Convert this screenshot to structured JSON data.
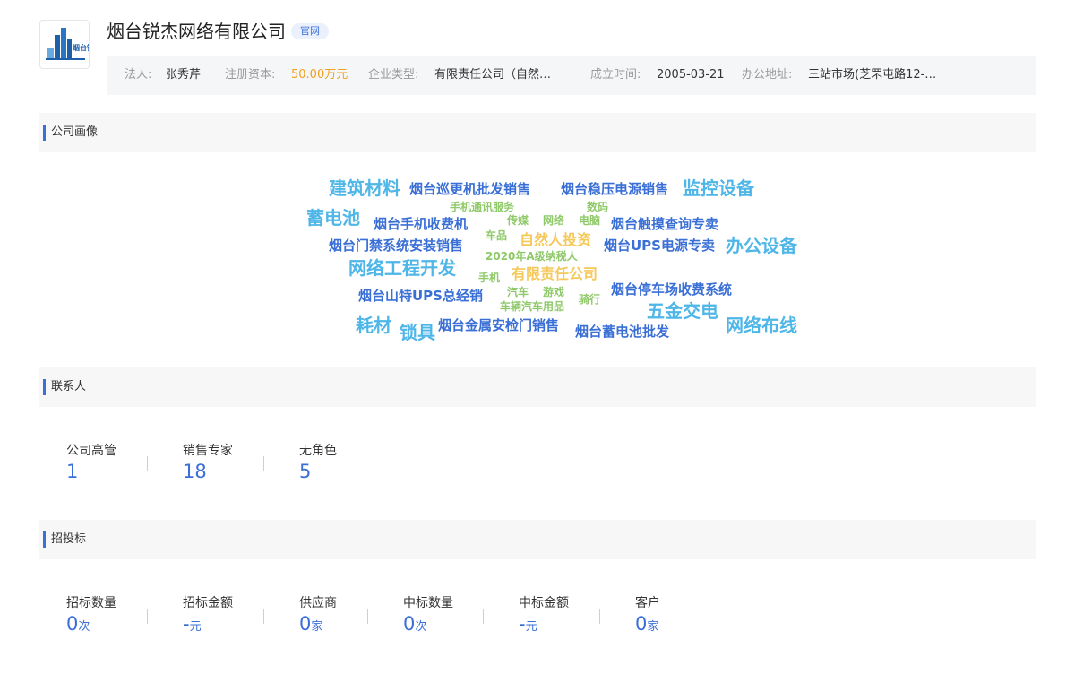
{
  "company": {
    "name": "烟台锐杰网络有限公司",
    "badge": "官网",
    "logo_text": "烟台锐杰"
  },
  "info": {
    "legal_rep_label": "法人:",
    "legal_rep": "张秀芹",
    "capital_label": "注册资本:",
    "capital": "50.00万元",
    "type_label": "企业类型:",
    "type": "有限责任公司（自然…",
    "founded_label": "成立时间:",
    "founded": "2005-03-21",
    "address_label": "办公地址:",
    "address": "三站市场(芝罘屯路12-…"
  },
  "sections": {
    "portrait": "公司画像",
    "contacts": "联系人",
    "bidding": "招投标"
  },
  "word_cloud": [
    {
      "text": "建筑材料",
      "color": "#4fb6e8"
    },
    {
      "text": "烟台巡更机批发销售",
      "color": "#3a6fd6"
    },
    {
      "text": "烟台稳压电源销售",
      "color": "#3a6fd6"
    },
    {
      "text": "监控设备",
      "color": "#4fb6e8"
    },
    {
      "text": "手机通讯服务",
      "color": "#8fc96a"
    },
    {
      "text": "数码",
      "color": "#8fc96a"
    },
    {
      "text": "蓄电池",
      "color": "#4fb6e8"
    },
    {
      "text": "烟台手机收费机",
      "color": "#3a6fd6"
    },
    {
      "text": "传媒",
      "color": "#8fc96a"
    },
    {
      "text": "网络",
      "color": "#8fc96a"
    },
    {
      "text": "电脑",
      "color": "#8fc96a"
    },
    {
      "text": "烟台触摸查询专卖",
      "color": "#3a6fd6"
    },
    {
      "text": "车品",
      "color": "#8fc96a"
    },
    {
      "text": "自然人投资",
      "color": "#f5c85a"
    },
    {
      "text": "烟台门禁系统安装销售",
      "color": "#3a6fd6"
    },
    {
      "text": "烟台UPS电源专卖",
      "color": "#3a6fd6"
    },
    {
      "text": "办公设备",
      "color": "#4fb6e8"
    },
    {
      "text": "2020年A级纳税人",
      "color": "#8fc96a"
    },
    {
      "text": "网络工程开发",
      "color": "#4fb6e8"
    },
    {
      "text": "手机",
      "color": "#8fc96a"
    },
    {
      "text": "有限责任公司",
      "color": "#f5c85a"
    },
    {
      "text": "烟台山特UPS总经销",
      "color": "#3a6fd6"
    },
    {
      "text": "汽车",
      "color": "#8fc96a"
    },
    {
      "text": "游戏",
      "color": "#8fc96a"
    },
    {
      "text": "骑行",
      "color": "#8fc96a"
    },
    {
      "text": "烟台停车场收费系统",
      "color": "#3a6fd6"
    },
    {
      "text": "车辆汽车用品",
      "color": "#8fc96a"
    },
    {
      "text": "五金交电",
      "color": "#4fb6e8"
    },
    {
      "text": "耗材",
      "color": "#4fb6e8"
    },
    {
      "text": "锁具",
      "color": "#4fb6e8"
    },
    {
      "text": "烟台金属安检门销售",
      "color": "#3a6fd6"
    },
    {
      "text": "烟台蓄电池批发",
      "color": "#3a6fd6"
    },
    {
      "text": "网络布线",
      "color": "#4fb6e8"
    }
  ],
  "contacts": [
    {
      "label": "公司高管",
      "value": "1"
    },
    {
      "label": "销售专家",
      "value": "18"
    },
    {
      "label": "无角色",
      "value": "5"
    }
  ],
  "bidding": [
    {
      "label": "招标数量",
      "value": "0",
      "unit": "次"
    },
    {
      "label": "招标金额",
      "value": "-",
      "unit": "元"
    },
    {
      "label": "供应商",
      "value": "0",
      "unit": "家"
    },
    {
      "label": "中标数量",
      "value": "0",
      "unit": "次"
    },
    {
      "label": "中标金额",
      "value": "-",
      "unit": "元"
    },
    {
      "label": "客户",
      "value": "0",
      "unit": "家"
    }
  ],
  "colors": {
    "accent": "#3a6fd6",
    "capital": "#f0a020"
  }
}
